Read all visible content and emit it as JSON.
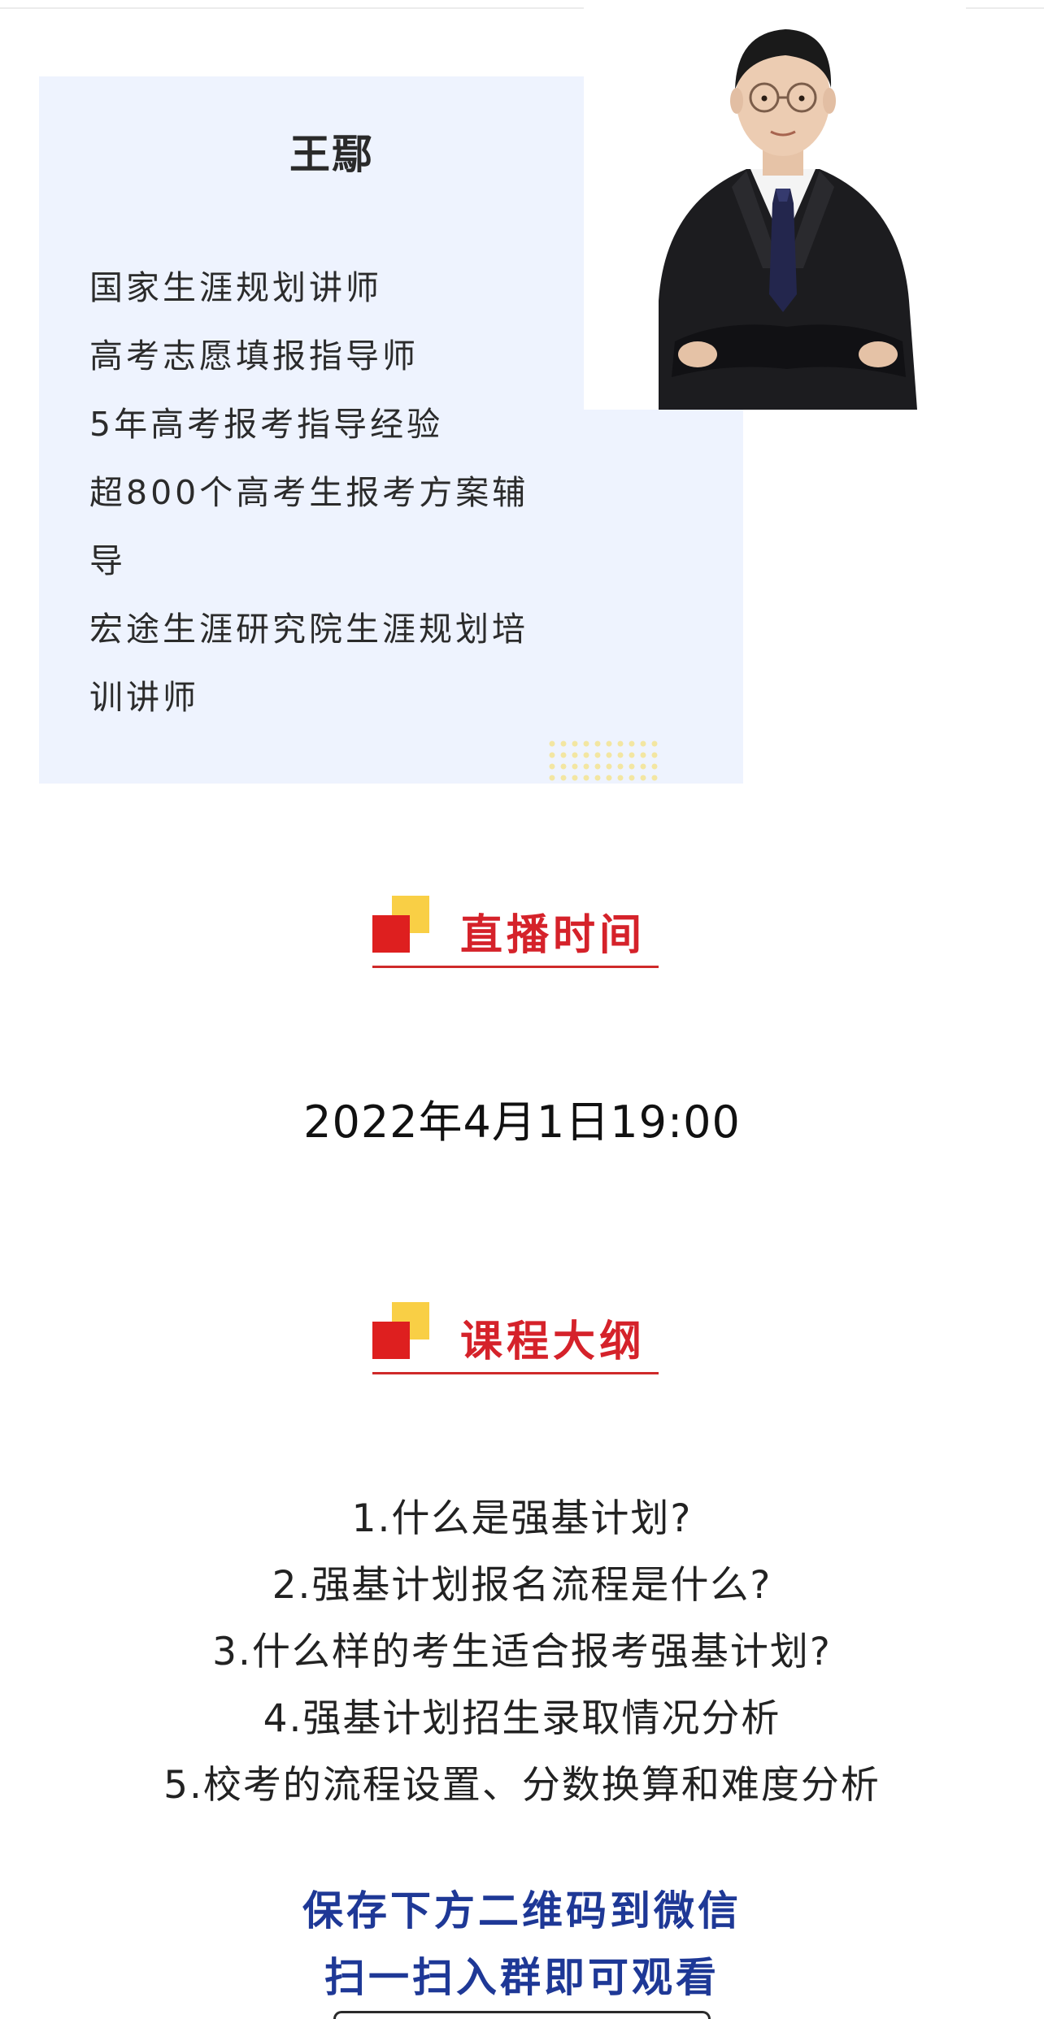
{
  "teacher": {
    "name": "王鄢",
    "bio": [
      "国家生涯规划讲师",
      "高考志愿填报指导师",
      "5年高考报考指导经验",
      "超800个高考生报考方案辅",
      "导",
      "宏途生涯研究院生涯规划培",
      "训讲师"
    ]
  },
  "live_section": {
    "title": "直播时间",
    "datetime": "2022年4月1日19:00"
  },
  "outline_section": {
    "title": "课程大纲",
    "items": [
      "1.什么是强基计划?",
      "2.强基计划报名流程是什么?",
      "3.什么样的考生适合报考强基计划?",
      "4.强基计划招生录取情况分析",
      "5.校考的流程设置、分数换算和难度分析"
    ]
  },
  "cta": {
    "line1": "保存下方二维码到微信",
    "line2": "扫一扫入群即可观看"
  },
  "colors": {
    "accent_red": "#d5222a",
    "accent_yellow": "#f9cf45",
    "cta_blue": "#1e3896",
    "panel_bg": "#eef3fe"
  }
}
